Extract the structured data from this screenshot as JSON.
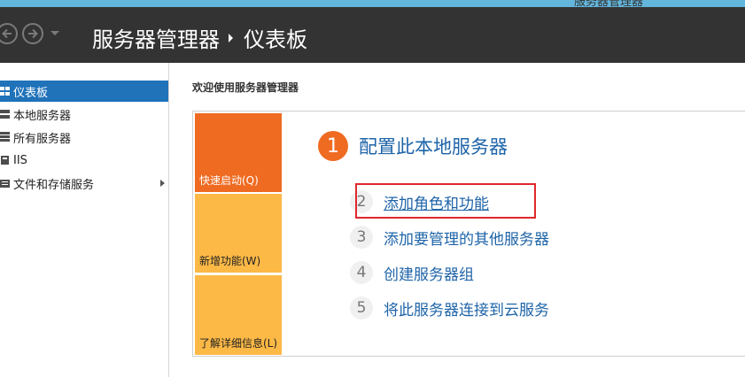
{
  "window": {
    "title": "服务器管理器"
  },
  "header": {
    "breadcrumb_root": "服务器管理器",
    "breadcrumb_current": "仪表板"
  },
  "sidebar": {
    "items": [
      {
        "label": "仪表板",
        "icon": "dashboard-icon",
        "active": true
      },
      {
        "label": "本地服务器",
        "icon": "server-icon",
        "active": false
      },
      {
        "label": "所有服务器",
        "icon": "servers-icon",
        "active": false
      },
      {
        "label": "IIS",
        "icon": "iis-icon",
        "active": false
      },
      {
        "label": "文件和存储服务",
        "icon": "storage-icon",
        "active": false,
        "has_submenu": true
      }
    ]
  },
  "main": {
    "welcome_title": "欢迎使用服务器管理器",
    "tiles": [
      {
        "label": "快速启动(Q)",
        "color": "#ef6b21"
      },
      {
        "label": "新增功能(W)",
        "color": "#fdb946"
      },
      {
        "label": "了解详细信息(L)",
        "color": "#fdb946"
      }
    ],
    "primary_step": {
      "number": "1",
      "label": "配置此本地服务器"
    },
    "steps": [
      {
        "number": "2",
        "label": "添加角色和功能"
      },
      {
        "number": "3",
        "label": "添加要管理的其他服务器"
      },
      {
        "number": "4",
        "label": "创建服务器组"
      },
      {
        "number": "5",
        "label": "将此服务器连接到云服务"
      }
    ]
  },
  "colors": {
    "accent_orange": "#ef6b21",
    "tile_yellow": "#fdb946",
    "link_blue": "#1e64a8",
    "sidebar_active": "#2072b9",
    "header_bg": "#333333",
    "highlight_red": "#e0282c"
  }
}
